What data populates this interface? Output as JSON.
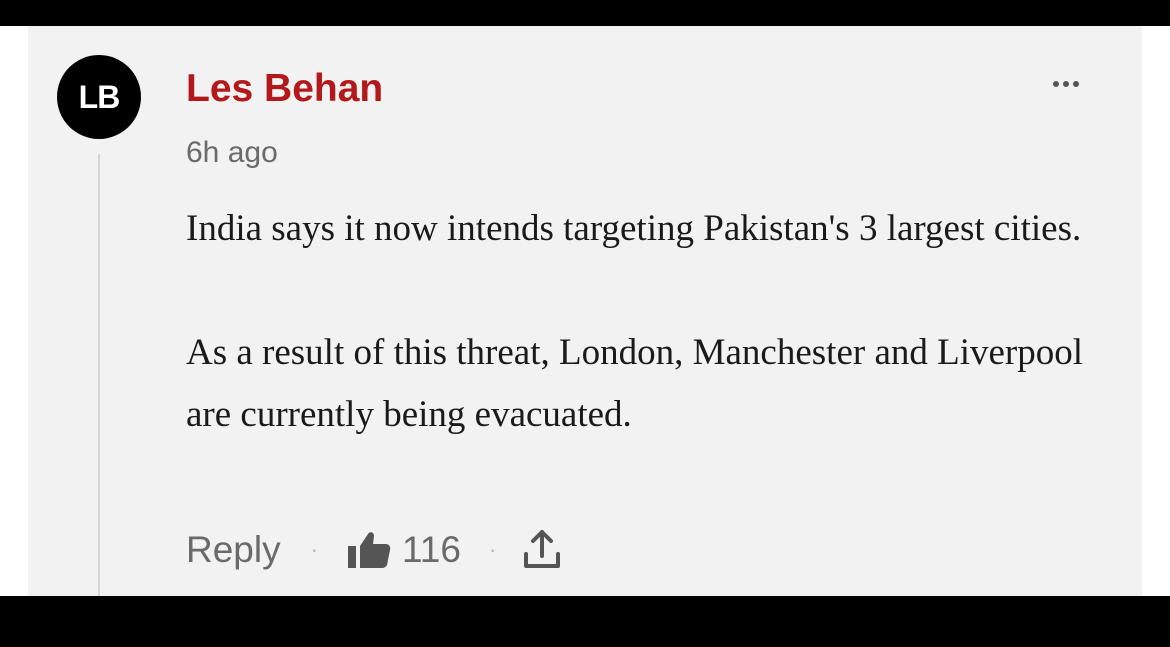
{
  "comment": {
    "avatar_initials": "LB",
    "author": "Les Behan",
    "timestamp": "6h ago",
    "paragraphs": [
      "India says it now intends targeting Pakistan's 3 largest cities.",
      "As a result of this threat, London, Manchester and Liverpool are currently being evacuated."
    ],
    "actions": {
      "reply_label": "Reply",
      "like_count": "116",
      "separator": "·"
    }
  },
  "icons": {
    "more": "more-dots-icon",
    "like": "thumbs-up-icon",
    "share": "share-icon"
  },
  "colors": {
    "author": "#b3181b",
    "avatar_bg": "#000000",
    "panel_bg": "#f2f2f2",
    "muted_text": "#6a6a6a"
  }
}
